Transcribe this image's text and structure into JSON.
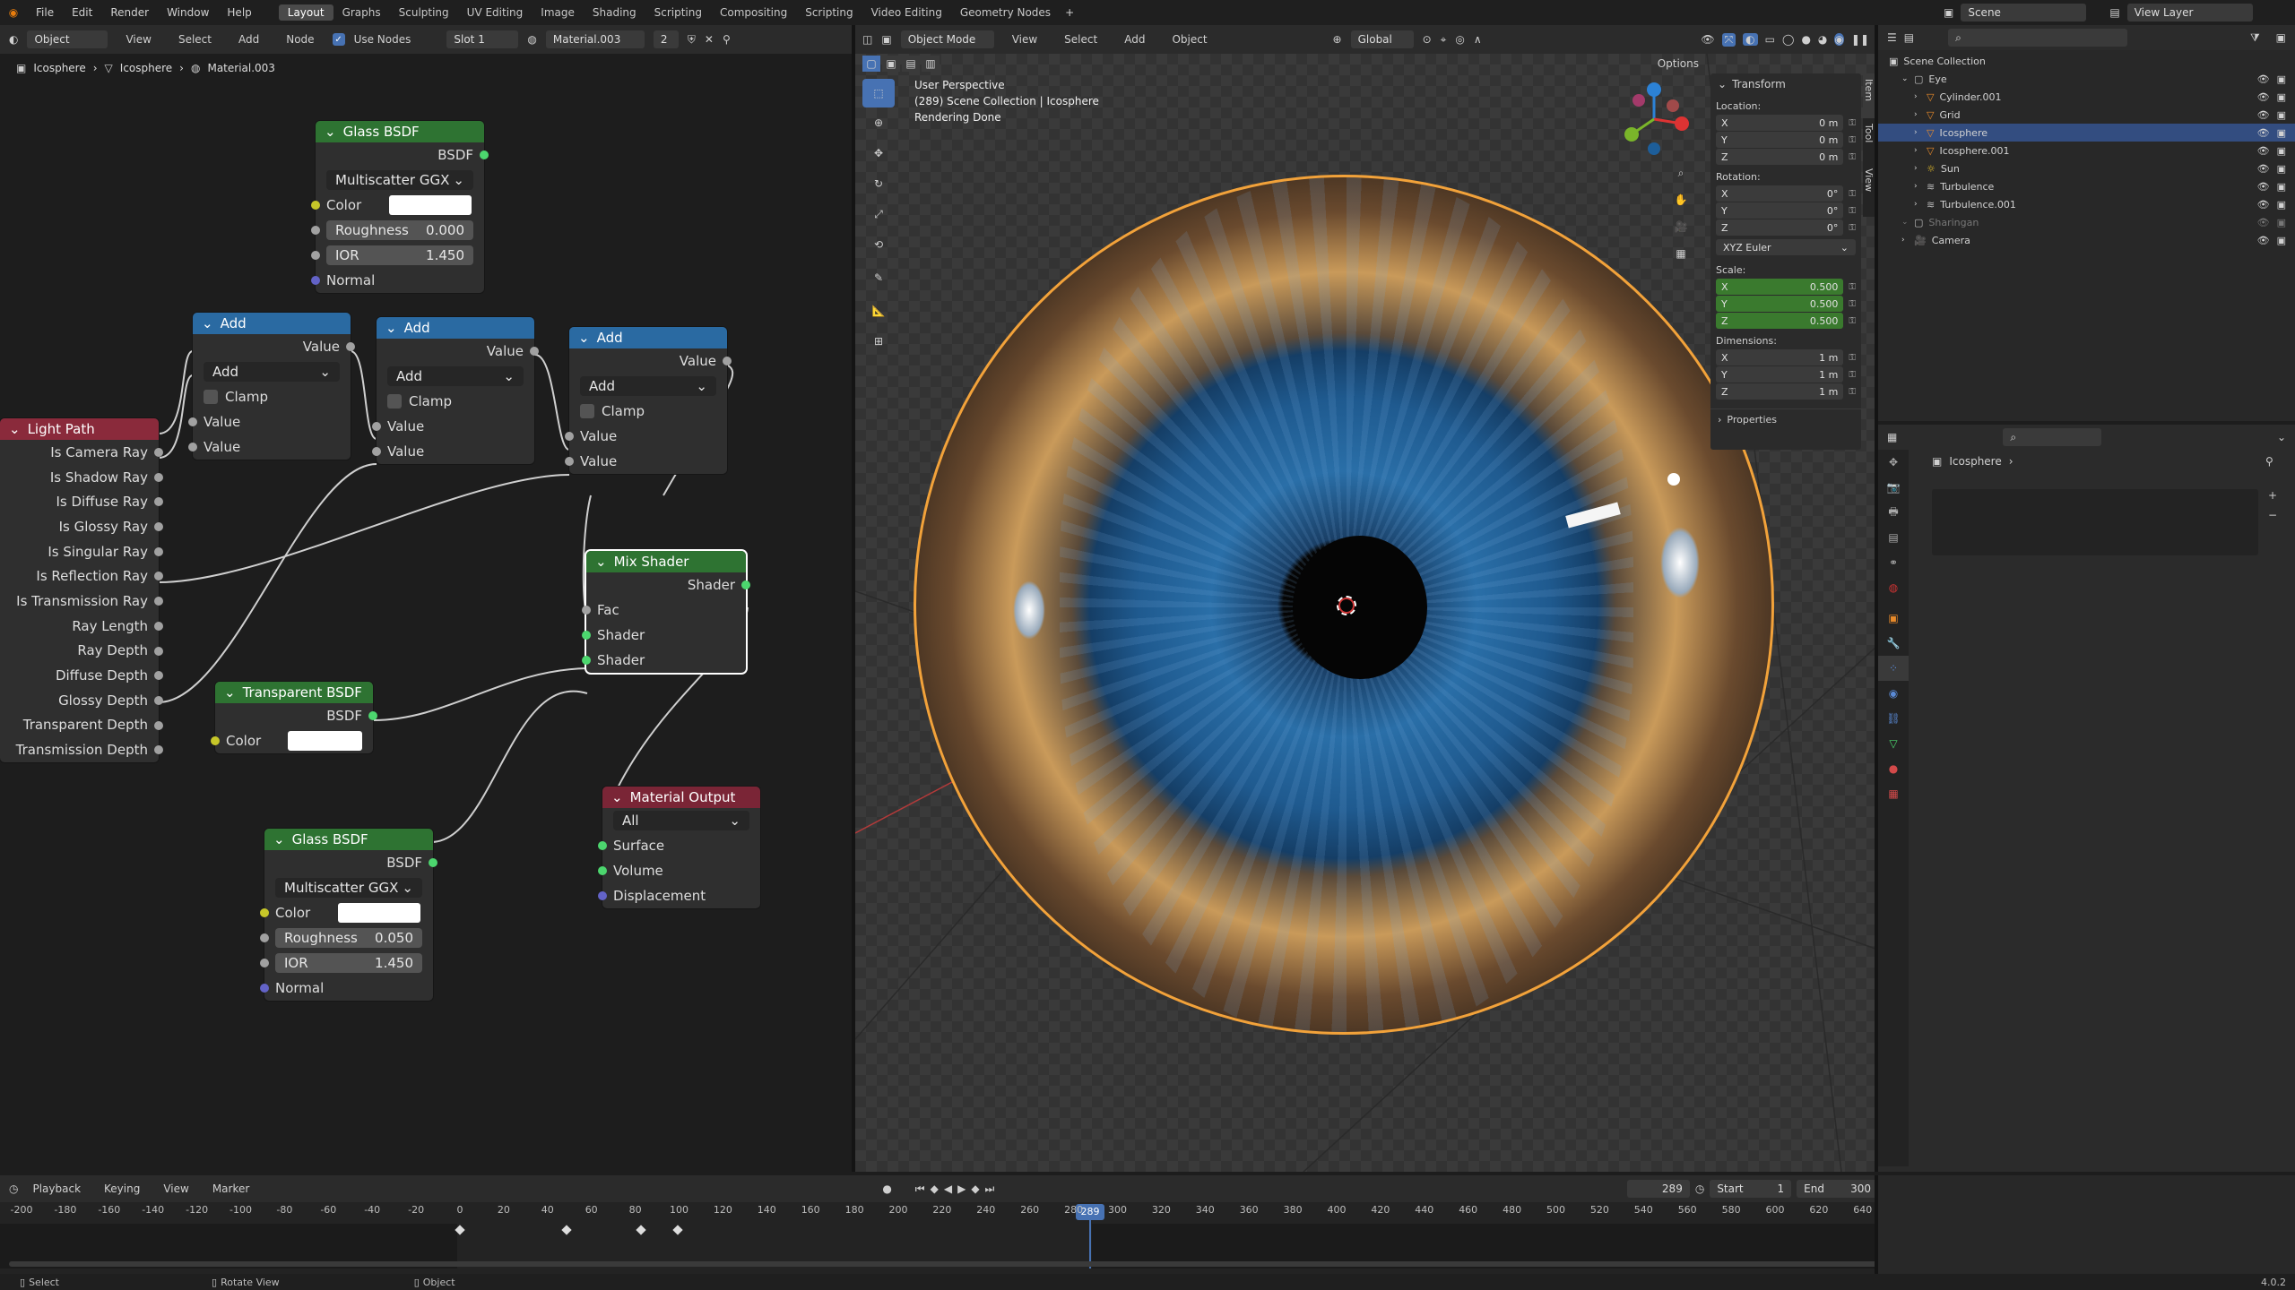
{
  "topbar": {
    "menus": [
      "File",
      "Edit",
      "Render",
      "Window",
      "Help"
    ],
    "tabs": [
      "Layout",
      "Graphs",
      "Sculpting",
      "UV Editing",
      "Image",
      "Shading",
      "Scripting",
      "Compositing",
      "Scripting",
      "Video Editing",
      "Geometry Nodes"
    ],
    "active_tab": "Layout",
    "scene": "Scene",
    "view_layer": "View Layer"
  },
  "node_editor": {
    "header": {
      "mode": "Object",
      "menus": [
        "View",
        "Select",
        "Add",
        "Node"
      ],
      "use_nodes": "Use Nodes",
      "slot": "Slot 1",
      "material": "Material.003",
      "users": "2"
    },
    "breadcrumb": [
      "Icosphere",
      "Icosphere",
      "Material.003"
    ],
    "nodes": {
      "glass1": {
        "title": "Glass BSDF",
        "output": "BSDF",
        "dist": "Multiscatter GGX",
        "color": "Color",
        "rough_label": "Roughness",
        "rough": "0.000",
        "ior_label": "IOR",
        "ior": "1.450",
        "normal": "Normal"
      },
      "add1": {
        "title": "Add",
        "output": "Value",
        "op": "Add",
        "clamp": "Clamp",
        "in1": "Value",
        "in2": "Value"
      },
      "add2": {
        "title": "Add",
        "output": "Value",
        "op": "Add",
        "clamp": "Clamp",
        "in1": "Value",
        "in2": "Value"
      },
      "add3": {
        "title": "Add",
        "output": "Value",
        "op": "Add",
        "clamp": "Clamp",
        "in1": "Value",
        "in2": "Value"
      },
      "lightpath": {
        "title": "Light Path",
        "outputs": [
          "Is Camera Ray",
          "Is Shadow Ray",
          "Is Diffuse Ray",
          "Is Glossy Ray",
          "Is Singular Ray",
          "Is Reflection Ray",
          "Is Transmission Ray",
          "Ray Length",
          "Ray Depth",
          "Diffuse Depth",
          "Glossy Depth",
          "Transparent Depth",
          "Transmission Depth"
        ]
      },
      "mix": {
        "title": "Mix Shader",
        "output": "Shader",
        "fac": "Fac",
        "in1": "Shader",
        "in2": "Shader"
      },
      "transparent": {
        "title": "Transparent BSDF",
        "output": "BSDF",
        "color": "Color"
      },
      "glass2": {
        "title": "Glass BSDF",
        "output": "BSDF",
        "dist": "Multiscatter GGX",
        "color": "Color",
        "rough_label": "Roughness",
        "rough": "0.050",
        "ior_label": "IOR",
        "ior": "1.450",
        "normal": "Normal"
      },
      "output": {
        "title": "Material Output",
        "target": "All",
        "surface": "Surface",
        "volume": "Volume",
        "displacement": "Displacement"
      }
    }
  },
  "viewport": {
    "header": {
      "mode": "Object Mode",
      "menus": [
        "View",
        "Select",
        "Add",
        "Object"
      ],
      "orientation": "Global",
      "options": "Options"
    },
    "overlay": [
      "User Perspective",
      "(289) Scene Collection | Icosphere",
      "Rendering Done"
    ],
    "npanel": {
      "tabs": [
        "Item",
        "Tool",
        "View"
      ],
      "title": "Transform",
      "location_label": "Location:",
      "location": [
        {
          "axis": "X",
          "value": "0 m"
        },
        {
          "axis": "Y",
          "value": "0 m"
        },
        {
          "axis": "Z",
          "value": "0 m"
        }
      ],
      "rotation_label": "Rotation:",
      "rotation": [
        {
          "axis": "X",
          "value": "0°"
        },
        {
          "axis": "Y",
          "value": "0°"
        },
        {
          "axis": "Z",
          "value": "0°"
        }
      ],
      "rot_mode": "XYZ Euler",
      "scale_label": "Scale:",
      "scale": [
        {
          "axis": "X",
          "value": "0.500"
        },
        {
          "axis": "Y",
          "value": "0.500"
        },
        {
          "axis": "Z",
          "value": "0.500"
        }
      ],
      "dimensions_label": "Dimensions:",
      "dimensions": [
        {
          "axis": "X",
          "value": "1 m"
        },
        {
          "axis": "Y",
          "value": "1 m"
        },
        {
          "axis": "Z",
          "value": "1 m"
        }
      ],
      "properties": "Properties"
    }
  },
  "outliner": {
    "root": "Scene Collection",
    "items": [
      {
        "name": "Eye",
        "depth": 1,
        "type": "collection"
      },
      {
        "name": "Cylinder.001",
        "depth": 2,
        "type": "mesh"
      },
      {
        "name": "Grid",
        "depth": 2,
        "type": "mesh"
      },
      {
        "name": "Icosphere",
        "depth": 2,
        "type": "mesh",
        "selected": true
      },
      {
        "name": "Icosphere.001",
        "depth": 2,
        "type": "mesh"
      },
      {
        "name": "Sun",
        "depth": 2,
        "type": "light"
      },
      {
        "name": "Turbulence",
        "depth": 2,
        "type": "force"
      },
      {
        "name": "Turbulence.001",
        "depth": 2,
        "type": "force"
      },
      {
        "name": "Sharingan",
        "depth": 1,
        "type": "collection",
        "dim": true
      },
      {
        "name": "Camera",
        "depth": 1,
        "type": "camera"
      }
    ]
  },
  "properties": {
    "object": "Icosphere"
  },
  "timeline": {
    "menus": [
      "Playback",
      "Keying",
      "View",
      "Marker"
    ],
    "current": "289",
    "start_label": "Start",
    "start": "1",
    "end_label": "End",
    "end": "300",
    "ticks": [
      "-200",
      "-180",
      "-160",
      "-140",
      "-120",
      "-100",
      "-80",
      "-60",
      "-40",
      "-20",
      "0",
      "20",
      "40",
      "60",
      "80",
      "100",
      "120",
      "140",
      "160",
      "180",
      "200",
      "220",
      "240",
      "260",
      "280",
      "300",
      "320",
      "340",
      "360",
      "380",
      "400",
      "420",
      "440",
      "460",
      "480",
      "500",
      "520",
      "540",
      "560",
      "580",
      "600",
      "620",
      "640"
    ],
    "playhead": "289"
  },
  "statusbar": {
    "select": "Select",
    "rotate": "Rotate View",
    "object": "Object",
    "version": "4.0.2"
  },
  "colors": {
    "accent": "#4772b3",
    "green_header": "#2e7332",
    "blue_header": "#2a6aa2",
    "red_header": "#8a2a3b",
    "output_header": "#7a2536",
    "selection": "#f2a23a"
  }
}
